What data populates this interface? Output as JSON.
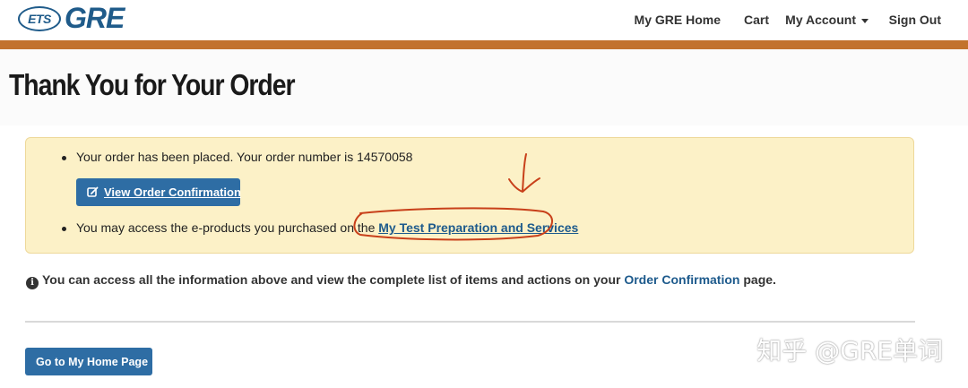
{
  "header": {
    "logo_ets": "ETS",
    "logo_gre": "GRE",
    "nav": {
      "home": "My GRE Home",
      "cart": "Cart",
      "account": "My Account",
      "signout": "Sign Out"
    }
  },
  "page": {
    "title": "Thank You for Your Order"
  },
  "alert": {
    "order_text": "Your order has been placed. Your order number is 14570058",
    "view_button": "View Order Confirmation",
    "access_text": "You may access the e-products you purchased on the ",
    "access_link": "My Test Preparation and Services"
  },
  "info": {
    "text_before": "You can access all the information above and view the complete list of items and actions on your ",
    "link": "Order Confirmation",
    "text_after": " page."
  },
  "buttons": {
    "home": "Go to My Home Page"
  },
  "watermark": "知乎 @GRE单词",
  "colors": {
    "accent_bar": "#c2722e",
    "primary_button": "#2e6da4",
    "alert_bg": "#fcf1c7",
    "link": "#1d5a8c",
    "annotation": "#c8401a"
  },
  "icons": {
    "edit": "edit-icon",
    "info": "info-icon",
    "caret": "caret-down-icon"
  }
}
